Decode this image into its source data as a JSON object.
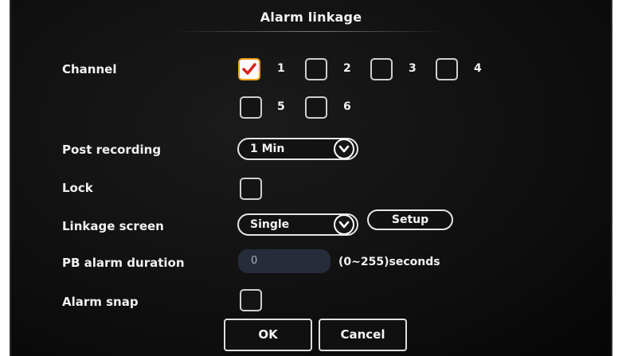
{
  "dialog": {
    "title": "Alarm linkage"
  },
  "channel": {
    "label": "Channel",
    "options": [
      {
        "num": "1",
        "checked": true
      },
      {
        "num": "2",
        "checked": false
      },
      {
        "num": "3",
        "checked": false
      },
      {
        "num": "4",
        "checked": false
      },
      {
        "num": "5",
        "checked": false
      },
      {
        "num": "6",
        "checked": false
      }
    ]
  },
  "post_recording": {
    "label": "Post recording",
    "value": "1 Min"
  },
  "lock": {
    "label": "Lock",
    "checked": false
  },
  "linkage_screen": {
    "label": "Linkage screen",
    "value": "Single",
    "setup_label": "Setup"
  },
  "pb_alarm_duration": {
    "label": "PB alarm duration",
    "value": "0",
    "hint": "(0~255)seconds"
  },
  "alarm_snap": {
    "label": "Alarm snap",
    "checked": false
  },
  "buttons": {
    "ok": "OK",
    "cancel": "Cancel"
  },
  "colors": {
    "checked_border": "#f5a21a",
    "check_mark": "#d8241e",
    "field_bg": "#262c3a"
  }
}
